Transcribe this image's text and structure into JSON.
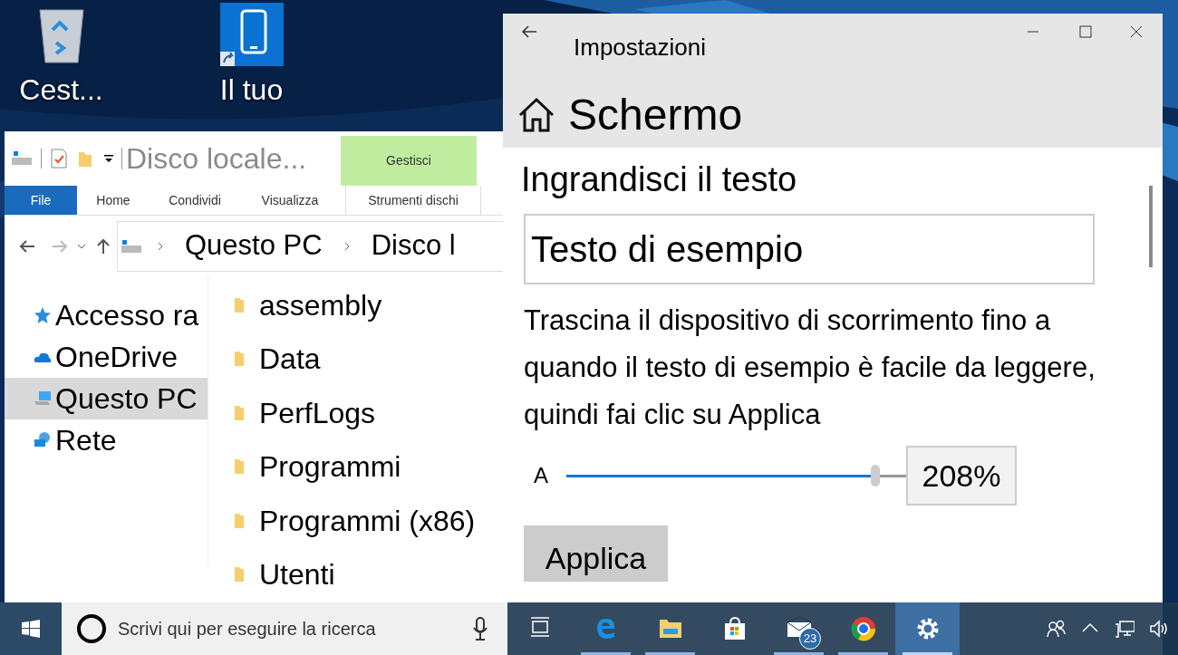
{
  "desktop": {
    "icons": [
      {
        "kind": "recycle-bin",
        "label": "Cest..."
      },
      {
        "kind": "phone",
        "label": "Il tuo"
      }
    ]
  },
  "explorer": {
    "title": "Disco locale...",
    "context_tab": "Gestisci",
    "ribbon_tabs": [
      {
        "label": "File",
        "selected": true
      },
      {
        "label": "Home",
        "selected": false
      },
      {
        "label": "Condividi",
        "selected": false
      },
      {
        "label": "Visualizza",
        "selected": false
      },
      {
        "label": "Strumenti dischi",
        "selected": false
      }
    ],
    "address": [
      "Questo PC",
      "Disco l"
    ],
    "nav_items": [
      {
        "kind": "star",
        "label": "Accesso ra",
        "selected": false
      },
      {
        "kind": "cloud",
        "label": "OneDrive",
        "selected": false
      },
      {
        "kind": "pc",
        "label": "Questo PC",
        "selected": true
      },
      {
        "kind": "network",
        "label": "Rete",
        "selected": false
      }
    ],
    "files": [
      "assembly",
      "Data",
      "PerfLogs",
      "Programmi",
      "Programmi (x86)",
      "Utenti"
    ]
  },
  "settings": {
    "title": "Impostazioni",
    "page_title": "Schermo",
    "section_title": "Ingrandisci il testo",
    "sample_text": "Testo di esempio",
    "instructions": "Trascina il dispositivo di scorrimento fino a quando il testo di esempio è facile da leggere, quindi fai clic su Applica",
    "slider": {
      "label": "A",
      "level": 0.91,
      "reading": "208%"
    },
    "apply_button": "Applica"
  },
  "taskbar": {
    "search_placeholder": "Scrivi qui per eseguire la ricerca",
    "apps": [
      {
        "kind": "task-view",
        "running": false,
        "active": false
      },
      {
        "kind": "edge",
        "running": true,
        "active": false
      },
      {
        "kind": "folder",
        "running": true,
        "active": false
      },
      {
        "kind": "store",
        "running": false,
        "active": false
      },
      {
        "kind": "mail",
        "running": true,
        "active": false,
        "badge": "23"
      },
      {
        "kind": "chrome",
        "running": true,
        "active": false
      },
      {
        "kind": "settings",
        "running": true,
        "active": true
      }
    ],
    "tray": [
      {
        "kind": "people"
      },
      {
        "kind": "caret"
      },
      {
        "kind": "network"
      },
      {
        "kind": "volume"
      }
    ]
  }
}
